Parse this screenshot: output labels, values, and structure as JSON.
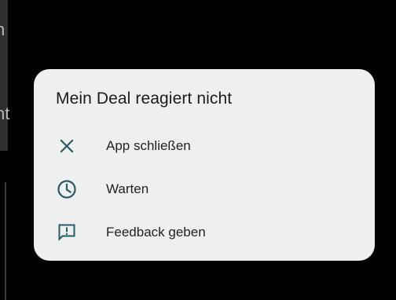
{
  "dialog": {
    "title": "Mein Deal reagiert nicht",
    "options": [
      {
        "icon": "close-icon",
        "label": "App schließen"
      },
      {
        "icon": "clock-icon",
        "label": "Warten"
      },
      {
        "icon": "feedback-icon",
        "label": "Feedback geben"
      }
    ]
  },
  "background": {
    "partial_text_top": "n",
    "partial_text_mid": "nt"
  },
  "colors": {
    "dialog_background": "#eef0ef",
    "icon_tint": "#2b5a66",
    "scrim": "#000000"
  }
}
